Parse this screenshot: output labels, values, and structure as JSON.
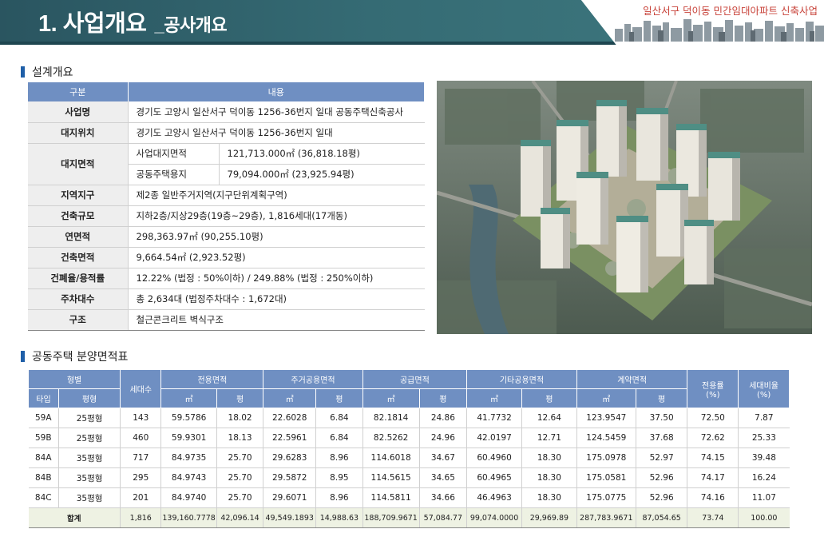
{
  "header": {
    "title_main": "1. 사업개요",
    "title_sub": "_공사개요",
    "project_name": "일산서구 덕이동 민간임대아파트 신축사업"
  },
  "overview": {
    "section_title": "설계개요",
    "col_category": "구분",
    "col_content": "내용",
    "rows": {
      "project_name": {
        "label": "사업명",
        "value": "경기도 고양시 일산서구 덕이동 1256-36번지 일대 공동주택신축공사"
      },
      "site_location": {
        "label": "대지위치",
        "value": "경기도 고양시 일산서구 덕이동 1256-36번지 일대"
      },
      "site_area": {
        "label": "대지면적",
        "sub1_label": "사업대지면적",
        "sub1_value": "121,713.000㎡ (36,818.18평)",
        "sub2_label": "공동주택용지",
        "sub2_value": "79,094.000㎡ (23,925.94평)"
      },
      "zoning": {
        "label": "지역지구",
        "value": "제2종 일반주거지역(지구단위계획구역)"
      },
      "building_scale": {
        "label": "건축규모",
        "value": "지하2층/지상29층(19층~29층), 1,816세대(17개동)"
      },
      "gross_floor_area": {
        "label": "연면적",
        "value": "298,363.97㎡ (90,255.10평)"
      },
      "building_area": {
        "label": "건축면적",
        "value": "9,664.54㎡ (2,923.52평)"
      },
      "coverage_far": {
        "label": "건폐율/용적률",
        "value": "12.22% (법정 : 50%이하) / 249.88% (법정 : 250%이하)"
      },
      "parking": {
        "label": "주차대수",
        "value": "총 2,634대 (법정주차대수 : 1,672대)"
      },
      "structure": {
        "label": "구조",
        "value": "철근콘크리트 벽식구조"
      }
    }
  },
  "area_table": {
    "section_title": "공동주택 분양면적표",
    "headers": {
      "type_group": "형별",
      "households": "세대수",
      "exclusive": "전용면적",
      "residential_common": "주거공용면적",
      "supply": "공급면적",
      "other_common": "기타공용면적",
      "contract": "계약면적",
      "exclusive_ratio": "전용률\n(%)",
      "household_ratio": "세대비율\n(%)",
      "type": "타입",
      "pyeong_type": "평형",
      "sqm": "㎡",
      "pyeong": "평"
    },
    "rows": [
      [
        "59A",
        "25평형",
        "143",
        "59.5786",
        "18.02",
        "22.6028",
        "6.84",
        "82.1814",
        "24.86",
        "41.7732",
        "12.64",
        "123.9547",
        "37.50",
        "72.50",
        "7.87"
      ],
      [
        "59B",
        "25평형",
        "460",
        "59.9301",
        "18.13",
        "22.5961",
        "6.84",
        "82.5262",
        "24.96",
        "42.0197",
        "12.71",
        "124.5459",
        "37.68",
        "72.62",
        "25.33"
      ],
      [
        "84A",
        "35평형",
        "717",
        "84.9735",
        "25.70",
        "29.6283",
        "8.96",
        "114.6018",
        "34.67",
        "60.4960",
        "18.30",
        "175.0978",
        "52.97",
        "74.15",
        "39.48"
      ],
      [
        "84B",
        "35평형",
        "295",
        "84.9743",
        "25.70",
        "29.5872",
        "8.95",
        "114.5615",
        "34.65",
        "60.4965",
        "18.30",
        "175.0581",
        "52.96",
        "74.17",
        "16.24"
      ],
      [
        "84C",
        "35평형",
        "201",
        "84.9740",
        "25.70",
        "29.6071",
        "8.96",
        "114.5811",
        "34.66",
        "46.4963",
        "18.30",
        "175.0775",
        "52.96",
        "74.16",
        "11.07"
      ]
    ],
    "total": [
      "합계",
      "1,816",
      "139,160.7778",
      "42,096.14",
      "49,549.1893",
      "14,988.63",
      "188,709.9671",
      "57,084.77",
      "99,074.0000",
      "29,969.89",
      "287,783.9671",
      "87,054.65",
      "73.74",
      "100.00"
    ]
  }
}
